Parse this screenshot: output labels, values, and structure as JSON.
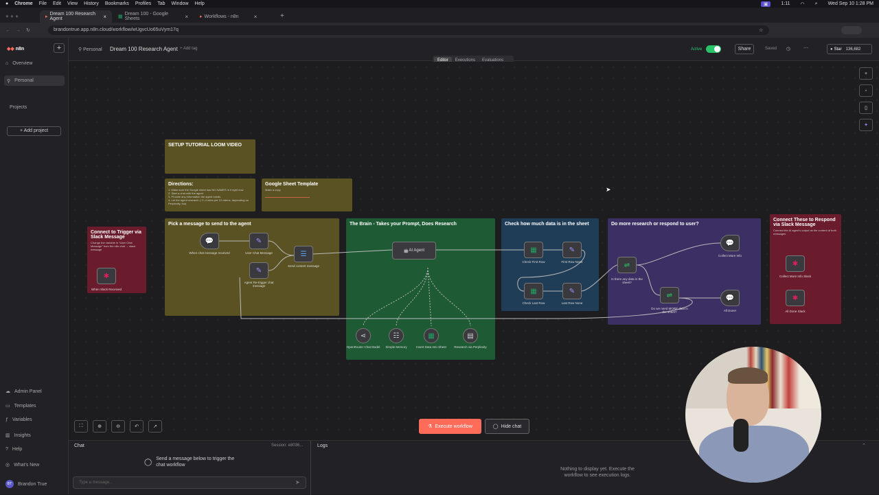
{
  "mac_menu": [
    "Chrome",
    "File",
    "Edit",
    "View",
    "History",
    "Bookmarks",
    "Profiles",
    "Tab",
    "Window",
    "Help"
  ],
  "mac_status": {
    "clock": "Wed Sep 10  1:28 PM",
    "timer": "1:11"
  },
  "browser_tabs": [
    {
      "title": "Dream 100 Research Agent",
      "active": true
    },
    {
      "title": "Dream 100 - Google Sheets",
      "active": false
    },
    {
      "title": "Workflows - n8n",
      "active": false
    }
  ],
  "url": "brandontrue.app.n8n.cloud/workflow/wUgvcUo65uVym17q",
  "topbar": {
    "breadcrumb_home": "Personal",
    "workflow_title": "Dream 100 Research Agent",
    "add_tag": "+ Add tag",
    "active_label": "Active",
    "share": "Share",
    "saved": "Saved",
    "star": "Star",
    "star_count": "136,682"
  },
  "view_tabs": [
    "Editor",
    "Executions",
    "Evaluations"
  ],
  "sidebar": {
    "logo": "n8n",
    "items": [
      {
        "label": "Overview"
      },
      {
        "label": "Personal"
      }
    ],
    "projects_label": "Projects",
    "add_project": "+ Add project",
    "footer": [
      {
        "label": "Admin Panel"
      },
      {
        "label": "Templates"
      },
      {
        "label": "Variables"
      },
      {
        "label": "Insights"
      },
      {
        "label": "Help"
      },
      {
        "label": "What's New"
      }
    ],
    "user_initials": "BT",
    "user": "Brandon True"
  },
  "stickies": {
    "video": {
      "title": "SETUP TUTORIAL LOOM VIDEO"
    },
    "directions": {
      "title": "Directions:",
      "body": "1. Make sure the Google sheet has NO NAMES in it right now\n2. Start a chat with the agent\n3. Provide any information the agent needs\n4. Let the agent research (~2–4 mins per 10 videos, depending on Perplexity, too)"
    },
    "sheet": {
      "title": "Google Sheet Template",
      "body": "Make a copy"
    },
    "slack_trigger": {
      "title": "Connect to Trigger via Slack Message",
      "body": "Change the variable in \"User Chat Message\" from the n8n chat → slack message"
    },
    "pick": {
      "title": "Pick a message to send to the agent"
    },
    "brain": {
      "title": "The Brain - Takes your Prompt, Does Research"
    },
    "check": {
      "title": "Check how much data is in the sheet"
    },
    "more": {
      "title": "Do more research or respond to user?"
    },
    "respond": {
      "title": "Connect These to Respond via Slack Message",
      "body": "Connect the AI agent's output as the content of both messages"
    }
  },
  "nodes": {
    "when_slack": "When Slack Received",
    "when_chat": "When chat message received",
    "user_chat": "User Chat Message",
    "agent_retrigger": "Agent Re-trigger chat message",
    "send_content": "Send content message",
    "ai_agent": "AI Agent",
    "openrouter": "OpenRouter Chat Model",
    "memory": "Simple Memory",
    "insert": "Insert Data Into Sheet",
    "research": "Research via Perplexity",
    "check_first": "Check First Row",
    "first_none": "First Row None",
    "check_last": "Check Last Row",
    "last_none": "Last Row None",
    "is_there": "Is there any data in the sheet?",
    "do_we_need": "Do we need MORE data in the sheet?",
    "collect_more": "Collect More Info",
    "all_done": "All Done!",
    "collect_slack": "Collect More Info Slack",
    "done_slack": "All Done Slack"
  },
  "canvas_buttons": {
    "execute": "Execute workflow",
    "hide_chat": "Hide chat"
  },
  "chat": {
    "header": "Chat",
    "session": "Session: e8036...",
    "hint": "Send a message below to trigger the chat workflow",
    "placeholder": "Type a message..."
  },
  "logs": {
    "header": "Logs",
    "empty": "Nothing to display yet. Execute the workflow to see execution logs."
  },
  "colors": {
    "accent": "#ff6d5a",
    "yellow": "#5a5222",
    "green": "#1e5b35",
    "blue": "#1f3d57",
    "purple": "#3b2f63",
    "red": "#6b1c2c",
    "toggle": "#29c46a"
  }
}
